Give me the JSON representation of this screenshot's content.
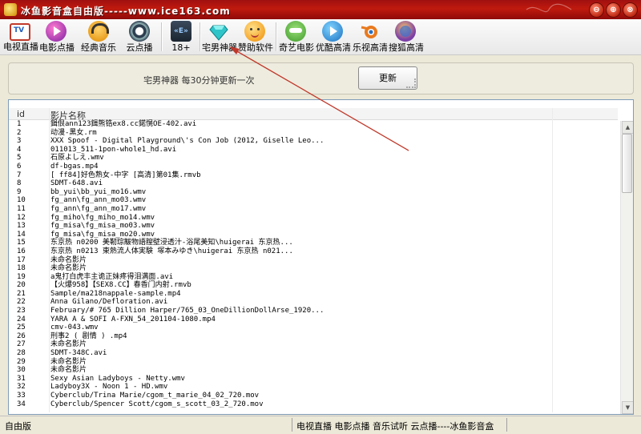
{
  "window": {
    "title": "冰鱼影音盒自由版-----www.ice163.com",
    "controls": [
      "⊖",
      "⊕",
      "⊗"
    ]
  },
  "toolbar": {
    "items": [
      {
        "label": "电视直播",
        "icon": "tv-icon",
        "color": "#c0392b"
      },
      {
        "label": "电影点播",
        "icon": "play-icon",
        "color": "#7b1fa2"
      },
      {
        "label": "经典音乐",
        "icon": "headphones-icon",
        "color": "#f39c12"
      },
      {
        "label": "云点播",
        "icon": "cloud-play-icon",
        "color": "#2c3e50"
      },
      {
        "label": "18+",
        "icon": "rewind-icon",
        "color": "#34495e"
      },
      {
        "label": "宅男神器",
        "icon": "diamond-icon",
        "color": "#1abc9c"
      },
      {
        "label": "赞助软件",
        "icon": "smiley-icon",
        "color": "#f5a623"
      },
      {
        "label": "奇艺电影",
        "icon": "iqiyi-icon",
        "color": "#5cb85c"
      },
      {
        "label": "优酷高清",
        "icon": "youku-icon",
        "color": "#2980b9"
      },
      {
        "label": "乐视高清",
        "icon": "blender-icon",
        "color": "#e67e22"
      },
      {
        "label": "搜狐高清",
        "icon": "sohu-icon",
        "color": "#8e44ad"
      }
    ]
  },
  "notice": {
    "text": "宅男神器  每30分钟更新一次",
    "refresh_label": "更新"
  },
  "list": {
    "columns": {
      "id": "id",
      "name": "影片名称"
    },
    "rows": [
      [
        "1",
        "鍓佷ann123鍓熊锆ex8.cc鍩愰OE-402.avi"
      ],
      [
        "2",
        "动漫-黑女.rm"
      ],
      [
        "3",
        "XXX Spoof - Digital Playground\\'s Con Job (2012, Giselle Leo..."
      ],
      [
        "4",
        "011013_511-1pon-whole1_hd.avi"
      ],
      [
        "5",
        "石原よしえ.wmv"
      ],
      [
        "6",
        "df-bgas.mp4"
      ],
      [
        "7",
        "[ ff84]好色熟女-中字 [高清]第01集.rmvb"
      ],
      [
        "8",
        "SDMT-648.avi"
      ],
      [
        "9",
        "bb_yui\\bb_yui_mo16.wmv"
      ],
      [
        "10",
        "fg_ann\\fg_ann_mo03.wmv"
      ],
      [
        "11",
        "fg_ann\\fg_ann_mo17.wmv"
      ],
      [
        "12",
        "fg_miho\\fg_miho_mo14.wmv"
      ],
      [
        "13",
        "fg_misa\\fg_misa_mo03.wmv"
      ],
      [
        "14",
        "fg_misa\\fg_misa_mo20.wmv"
      ],
      [
        "15",
        "东京热 n0200 美靭琮黻物語膣壁浸透汁-浴尾美知\\huigerai 东京热..."
      ],
      [
        "16",
        "东京热 n0213 東熱流人体実験  塚本みゆき\\huigerai 东京热 n021..."
      ],
      [
        "17",
        "未命名影片"
      ],
      [
        "18",
        "未命名影片"
      ],
      [
        "19",
        "a鬼打白虎丰主诡正妹疼得泪满面.avi"
      ],
      [
        "20",
        "【火爆958】【SEX8.CC】春香门内射.rmvb"
      ],
      [
        "21",
        "Sample/ma218nappale-sample.mp4"
      ],
      [
        "22",
        "Anna Gilano/Defloration.avi"
      ],
      [
        "23",
        "February/# 765 Dillion Harper/765_03_OneDillionDollArse_1920..."
      ],
      [
        "24",
        "YARA A & SOFI A-FXN_54_201104-1080.mp4"
      ],
      [
        "25",
        "cmv-043.wmv"
      ],
      [
        "26",
        "刑事2 ( 剧情 ) .mp4"
      ],
      [
        "27",
        "未命名影片"
      ],
      [
        "28",
        "SDMT-348C.avi"
      ],
      [
        "29",
        "未命名影片"
      ],
      [
        "30",
        "未命名影片"
      ],
      [
        "31",
        "Sexy Asian Ladyboys - Netty.wmv"
      ],
      [
        "32",
        "Ladyboy3X - Noon 1 - HD.wmv"
      ],
      [
        "33",
        "Cyberclub/Trina Marie/cgom_t_marie_04_02_720.mov"
      ],
      [
        "34",
        "Cyberclub/Spencer Scott/cgom_s_scott_03_2_720.mov"
      ]
    ]
  },
  "status": {
    "left": "自由版",
    "right": "电视直播  电影点播  音乐试听  云点播----冰鱼影音盒"
  },
  "colors": {
    "titlebar": "#b5150c",
    "annotation_arrow": "#c0392b"
  }
}
